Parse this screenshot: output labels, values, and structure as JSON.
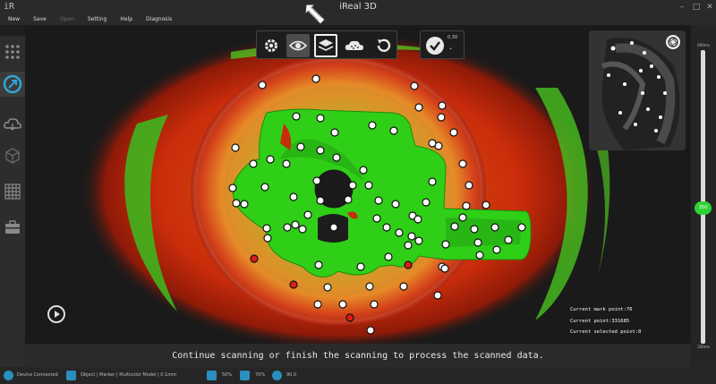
{
  "window": {
    "logo": "iR",
    "title": "iReal 3D"
  },
  "menu": {
    "items": [
      {
        "label": "New",
        "enabled": true
      },
      {
        "label": "Save",
        "enabled": true
      },
      {
        "label": "Open",
        "enabled": false
      },
      {
        "label": "Setting",
        "enabled": true
      },
      {
        "label": "Help",
        "enabled": true
      },
      {
        "label": "Diagnosis",
        "enabled": true
      }
    ]
  },
  "left_toolbar": {
    "tools": [
      {
        "icon": "grid-dots-icon",
        "active": false
      },
      {
        "icon": "scan-icon",
        "active": true
      },
      {
        "icon": "cloud-icon",
        "active": false
      },
      {
        "icon": "cube-icon",
        "active": false
      },
      {
        "icon": "mesh-grid-icon",
        "active": false
      },
      {
        "icon": "toolbox-icon",
        "active": false
      }
    ]
  },
  "top_toolbar": {
    "tools": [
      "gear-icon",
      "eye-icon",
      "layers-icon",
      "cloud-point-icon",
      "undo-icon"
    ],
    "highlighted": "eye-icon",
    "boxed": "layers-icon"
  },
  "resolution": {
    "label": "0.30",
    "icon": "checkmark-icon"
  },
  "slider": {
    "top_label": "600ms",
    "bottom_label": "200ms",
    "value_label": "350",
    "level": 0.5,
    "accent": "#2dd236"
  },
  "stats": {
    "mark_point": "Current mark point:76",
    "point": "Current point:331685",
    "selected_point": "Current selected point:0"
  },
  "message": "Continue scanning or finish the scanning to process the scanned data.",
  "statusbar": {
    "device": "Device Connected",
    "mode": "Object | Marker | Multicolor Model | 0.1mm",
    "v1": "50%",
    "v2": "70%",
    "v3": "90.0"
  },
  "colors": {
    "surface_green": "#39c41a",
    "heat_red": "#d62a0a",
    "heat_orange": "#e98a1a",
    "heat_yellow": "#b3c51f"
  }
}
